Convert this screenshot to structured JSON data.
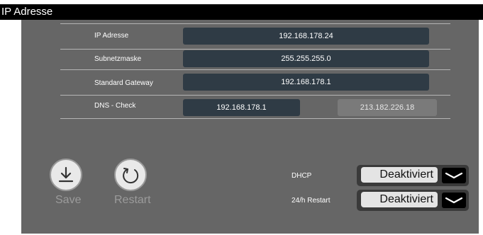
{
  "window": {
    "title": "IP Adresse"
  },
  "fields": [
    {
      "label": "IP Adresse",
      "value": "192.168.178.24"
    },
    {
      "label": "Subnetzmaske",
      "value": "255.255.255.0"
    },
    {
      "label": "Standard Gateway",
      "value": "192.168.178.1"
    }
  ],
  "dns": {
    "label": "DNS - Check",
    "primary": "192.168.178.1",
    "secondary": "213.182.226.18"
  },
  "buttons": {
    "save": "Save",
    "restart": "Restart"
  },
  "options": [
    {
      "label": "DHCP",
      "value": "Deaktiviert"
    },
    {
      "label": "24/h Restart",
      "value": "Deaktiviert"
    }
  ],
  "colors": {
    "panel": "#666666",
    "value_box": "#2f3b45",
    "titlebar": "#000000"
  },
  "icons": {
    "save": "download-icon",
    "restart": "refresh-icon",
    "dropdown": "chevron-down-icon"
  }
}
